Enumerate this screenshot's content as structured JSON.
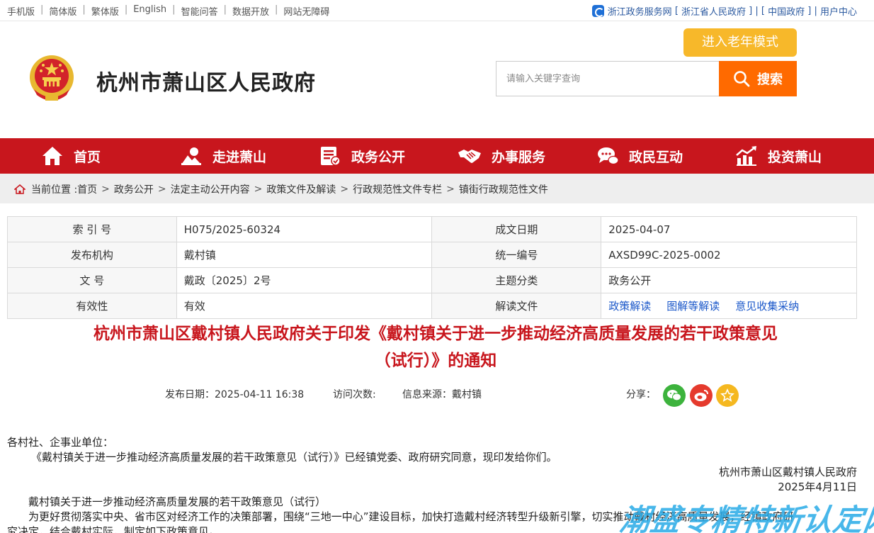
{
  "topbar": {
    "links": [
      "手机版",
      "简体版",
      "繁体版",
      "English",
      "智能问答",
      "数据开放",
      "网站无障碍"
    ],
    "right": {
      "service": "浙江政务服务网",
      "province_gov": "浙江省人民政府",
      "china_gov": "中国政府",
      "user_center": "用户中心"
    }
  },
  "header": {
    "site_title": "杭州市萧山区人民政府",
    "elder_mode": "进入老年模式",
    "search_placeholder": "请输入关键字查询",
    "search_button": "搜索"
  },
  "nav": [
    {
      "label": "首页",
      "icon": "home-icon"
    },
    {
      "label": "走进萧山",
      "icon": "landscape-icon"
    },
    {
      "label": "政务公开",
      "icon": "document-icon"
    },
    {
      "label": "办事服务",
      "icon": "handshake-icon"
    },
    {
      "label": "政民互动",
      "icon": "chat-icon"
    },
    {
      "label": "投资萧山",
      "icon": "chart-icon"
    }
  ],
  "breadcrumb": {
    "prefix": "当前位置 :",
    "items": [
      "首页",
      "政务公开",
      "法定主动公开内容",
      "政策文件及解读",
      "行政规范性文件专栏",
      "镇街行政规范性文件"
    ]
  },
  "meta": {
    "index_label": "索 引 号",
    "index_value": "H075/2025-60324",
    "date_label": "成文日期",
    "date_value": "2025-04-07",
    "org_label": "发布机构",
    "org_value": "戴村镇",
    "code_label": "统一编号",
    "code_value": "AXSD99C-2025-0002",
    "docno_label": "文 号",
    "docno_value": "戴政〔2025〕2号",
    "topic_label": "主题分类",
    "topic_value": "政务公开",
    "valid_label": "有效性",
    "valid_value": "有效",
    "interp_label": "解读文件",
    "interp_links": [
      "政策解读",
      "图解等解读",
      "意见收集采纳"
    ]
  },
  "article": {
    "title_line1": "杭州市萧山区戴村镇人民政府关于印发《戴村镇关于进一步推动经济高质量发展的若干政策意见",
    "title_line2": "（试行）》的通知",
    "publish_date": "发布日期：2025-04-11 16:38",
    "visits": "访问次数:",
    "source": "信息来源：戴村镇",
    "share_label": "分享：",
    "salutation": "各村社、企事业单位：",
    "para1": "《戴村镇关于进一步推动经济高质量发展的若干政策意见（试行）》已经镇党委、政府研究同意，现印发给你们。",
    "signature": "杭州市萧山区戴村镇人民政府",
    "sign_date": "2025年4月11日",
    "sub_title": "戴村镇关于进一步推动经济高质量发展的若干政策意见（试行）",
    "para2": "为更好贯彻落实中央、省市区对经济工作的决策部署，围绕“三地一中心”建设目标，加快打造戴村经济转型升级新引擎，切实推动戴村经济高质量发展，经镇政府研",
    "para3": "究决定，结合戴村实际，制定如下政策意见。"
  },
  "watermark": "潮盛专精特新认定网"
}
